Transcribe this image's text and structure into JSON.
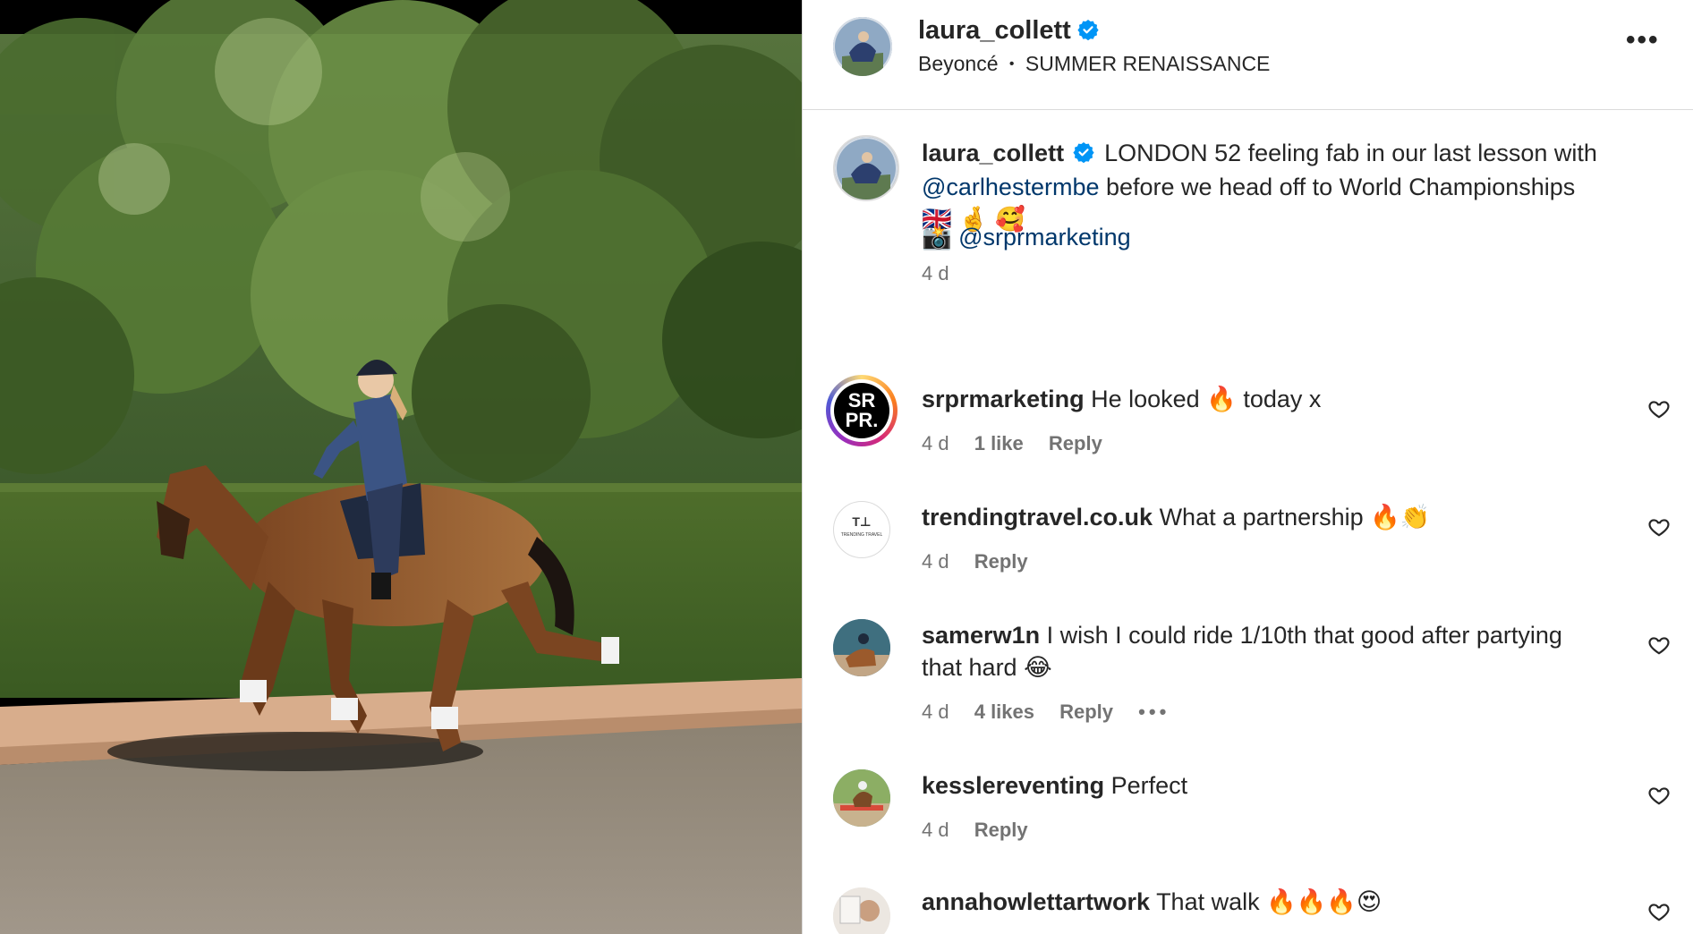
{
  "header": {
    "username": "laura_collett",
    "audio_artist": "Beyoncé",
    "audio_separator": "•",
    "audio_track": "SUMMER RENAISSANCE",
    "more_label": "•••"
  },
  "caption": {
    "username": "laura_collett",
    "text_1": "LONDON 52 feeling fab in our last lesson with",
    "mention_1": "@carlhestermbe",
    "text_2": "before we head off to World Championships",
    "emojis": [
      "🇬🇧",
      "🤞",
      "🥰"
    ],
    "credit_icon": "📸",
    "mention_2": "@srprmarketing",
    "time": "4 d"
  },
  "comments": [
    {
      "username": "srprmarketing",
      "text_before": "He looked",
      "emoji": "🔥",
      "text_after": "today x",
      "time": "4 d",
      "likes": "1 like",
      "reply": "Reply",
      "avatar_text": "SR PR."
    },
    {
      "username": "trendingtravel.co.uk",
      "text_before": "What a partnership",
      "emoji": "🔥👏",
      "text_after": "",
      "time": "4 d",
      "likes": "",
      "reply": "Reply",
      "avatar_text": "T⊥",
      "avatar_sub": "TRENDING TRAVEL"
    },
    {
      "username": "samerw1n",
      "text_before": "I wish I could ride 1/10th that good after partying",
      "line2": "that hard",
      "emoji": "😂",
      "time": "4 d",
      "likes": "4 likes",
      "reply": "Reply",
      "more": "•••"
    },
    {
      "username": "kesslereventing",
      "text_before": "Perfect",
      "emoji": "",
      "time": "4 d",
      "likes": "",
      "reply": "Reply"
    },
    {
      "username": "annahowlettartwork",
      "text_before": "That walk",
      "emoji": "🔥🔥🔥😍",
      "time": "",
      "likes": "",
      "reply": ""
    }
  ],
  "colors": {
    "verified_blue": "#0095f6",
    "mention_blue": "#00376b",
    "secondary_text": "#737373",
    "divider": "#dbdbdb"
  },
  "icons": [
    "verified-icon",
    "more-options-icon",
    "heart-icon",
    "camera-icon"
  ]
}
